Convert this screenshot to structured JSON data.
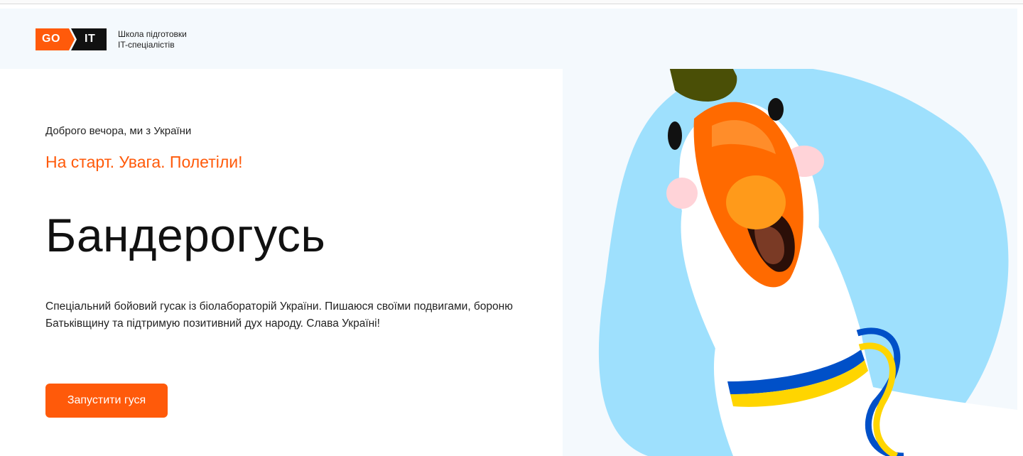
{
  "logo": {
    "left": "GO",
    "right": "IT",
    "tagline_line1": "Школа підготовки",
    "tagline_line2": "IT-спеціалістів"
  },
  "hero": {
    "greeting": "Доброго вечора, ми з України",
    "slogan": "На старт. Увага. Полетіли!",
    "title": "Бандерогусь",
    "description": "Спеціальний бойовий гусак із біолабораторій України. Пишаюся своїми подвигами, бороню Батьківщину та підтримую позитивний дух народу. Слава Україні!",
    "cta_label": "Запустити гуся"
  },
  "colors": {
    "accent": "#ff5a0a",
    "sky": "#9ee0fd",
    "hat": "#4a4f06",
    "ukraine_blue": "#0050c8",
    "ukraine_yellow": "#ffd500"
  },
  "icons": {
    "illustration": "goose-illustration-icon",
    "hat_emblem": "trident-icon"
  }
}
